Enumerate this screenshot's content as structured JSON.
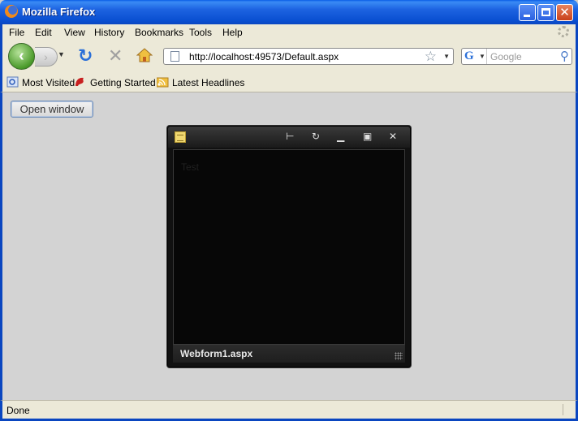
{
  "window": {
    "title": "Mozilla Firefox"
  },
  "menu": [
    "File",
    "Edit",
    "View",
    "History",
    "Bookmarks",
    "Tools",
    "Help"
  ],
  "navigation": {
    "url": "http://localhost:49573/Default.aspx",
    "search_placeholder": "Google"
  },
  "bookmarks": [
    "Most Visited",
    "Getting Started",
    "Latest Headlines"
  ],
  "content": {
    "open_button": "Open window"
  },
  "popup": {
    "body_text": "Test",
    "footer_title": "Webform1.aspx"
  },
  "status": {
    "text": "Done"
  },
  "colors": {
    "titlebar": "#0a5ee6",
    "content_bg": "#d3d3d3",
    "popup_bg": "#070707"
  }
}
